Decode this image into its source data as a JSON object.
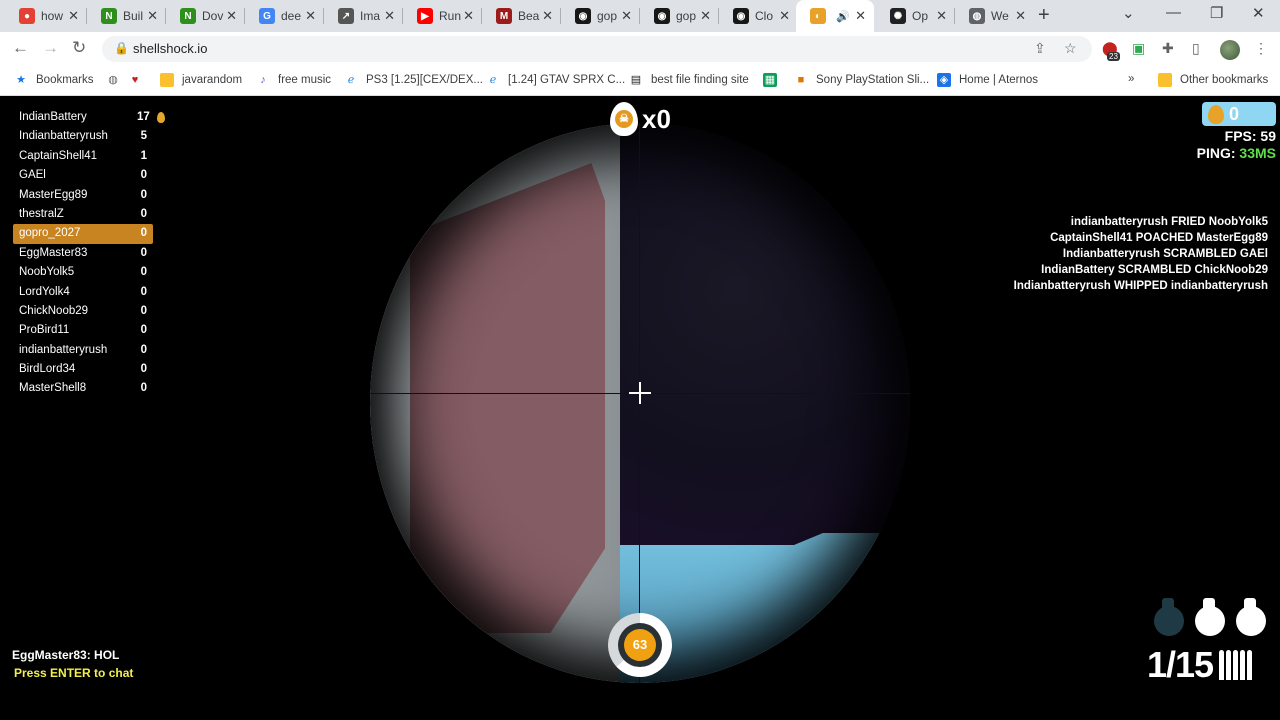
{
  "tabs": [
    {
      "title": "how",
      "icon": "multicolor-icon",
      "color": "#e34133"
    },
    {
      "title": "Buil",
      "icon": "nvidia-icon",
      "color": "#2f8f1c"
    },
    {
      "title": "Dov",
      "icon": "nvidia-icon",
      "color": "#2f8f1c"
    },
    {
      "title": "dee",
      "icon": "google-icon",
      "color": "#4285f4"
    },
    {
      "title": "Ima",
      "icon": "chart-icon",
      "color": "#555555"
    },
    {
      "title": "Run",
      "icon": "youtube-icon",
      "color": "#ff0000"
    },
    {
      "title": "Bea",
      "icon": "m-icon",
      "color": "#9c1c1c"
    },
    {
      "title": "gop",
      "icon": "github-icon",
      "color": "#181717"
    },
    {
      "title": "gop",
      "icon": "github-icon",
      "color": "#181717"
    },
    {
      "title": "Clo",
      "icon": "github-icon",
      "color": "#181717"
    },
    {
      "title": "",
      "icon": "egg-icon",
      "color": "#e8a22a"
    },
    {
      "title": "Op",
      "icon": "openai-icon",
      "color": "#202124"
    },
    {
      "title": "We",
      "icon": "globe-icon",
      "color": "#5f6368"
    }
  ],
  "url": "shellshock.io",
  "bookmarks": [
    {
      "label": "Bookmarks",
      "icon": "star-icon"
    },
    {
      "label": "",
      "icon": "globe-icon"
    },
    {
      "label": "",
      "icon": "heart-icon"
    },
    {
      "label": "javarandom",
      "icon": "folder-icon"
    },
    {
      "label": "free music",
      "icon": "music-icon"
    },
    {
      "label": "PS3 [1.25][CEX/DEX...",
      "icon": "e-icon"
    },
    {
      "label": "[1.24] GTAV SPRX C...",
      "icon": "e-icon"
    },
    {
      "label": "best file finding site",
      "icon": "filefinder-icon"
    },
    {
      "label": "",
      "icon": "app-icon"
    },
    {
      "label": "Sony PlayStation Sli...",
      "icon": "ps-icon"
    },
    {
      "label": "Home | Aternos",
      "icon": "aternos-icon"
    },
    {
      "label": "Other bookmarks",
      "icon": "folder-icon"
    }
  ],
  "scoreboard": [
    {
      "name": "IndianBattery",
      "score": "17"
    },
    {
      "name": "Indianbatteryrush",
      "score": "5"
    },
    {
      "name": "CaptainShell41",
      "score": "1"
    },
    {
      "name": "GAEl",
      "score": "0"
    },
    {
      "name": "MasterEgg89",
      "score": "0"
    },
    {
      "name": "thestralZ",
      "score": "0"
    },
    {
      "name": "gopro_2027",
      "score": "0"
    },
    {
      "name": "EggMaster83",
      "score": "0"
    },
    {
      "name": "NoobYolk5",
      "score": "0"
    },
    {
      "name": "LordYolk4",
      "score": "0"
    },
    {
      "name": "ChickNoob29",
      "score": "0"
    },
    {
      "name": "ProBird11",
      "score": "0"
    },
    {
      "name": "indianbatteryrush",
      "score": "0"
    },
    {
      "name": "BirdLord34",
      "score": "0"
    },
    {
      "name": "MasterShell8",
      "score": "0"
    }
  ],
  "killstreak": "x0",
  "eggs": "0",
  "fps": "FPS: 59",
  "ping_label": "PING: ",
  "ping_value": "33MS",
  "killfeed": [
    "indianbatteryrush FRIED NoobYolk5",
    "CaptainShell41 POACHED MasterEgg89",
    "Indianbatteryrush SCRAMBLED GAEl",
    "IndianBattery SCRAMBLED ChickNoob29",
    "Indianbatteryrush WHIPPED indianbatteryrush"
  ],
  "chat_message": "EggMaster83: HOL",
  "chat_hint": "Press ENTER to chat",
  "health": "63",
  "ammo": "1/15",
  "grenades_available": 2,
  "grenades_total": 3,
  "colors": {
    "accent": "#c98422",
    "ping_ok": "#5fe04a",
    "hint": "#f4f04a",
    "egg": "#e8a22a"
  }
}
